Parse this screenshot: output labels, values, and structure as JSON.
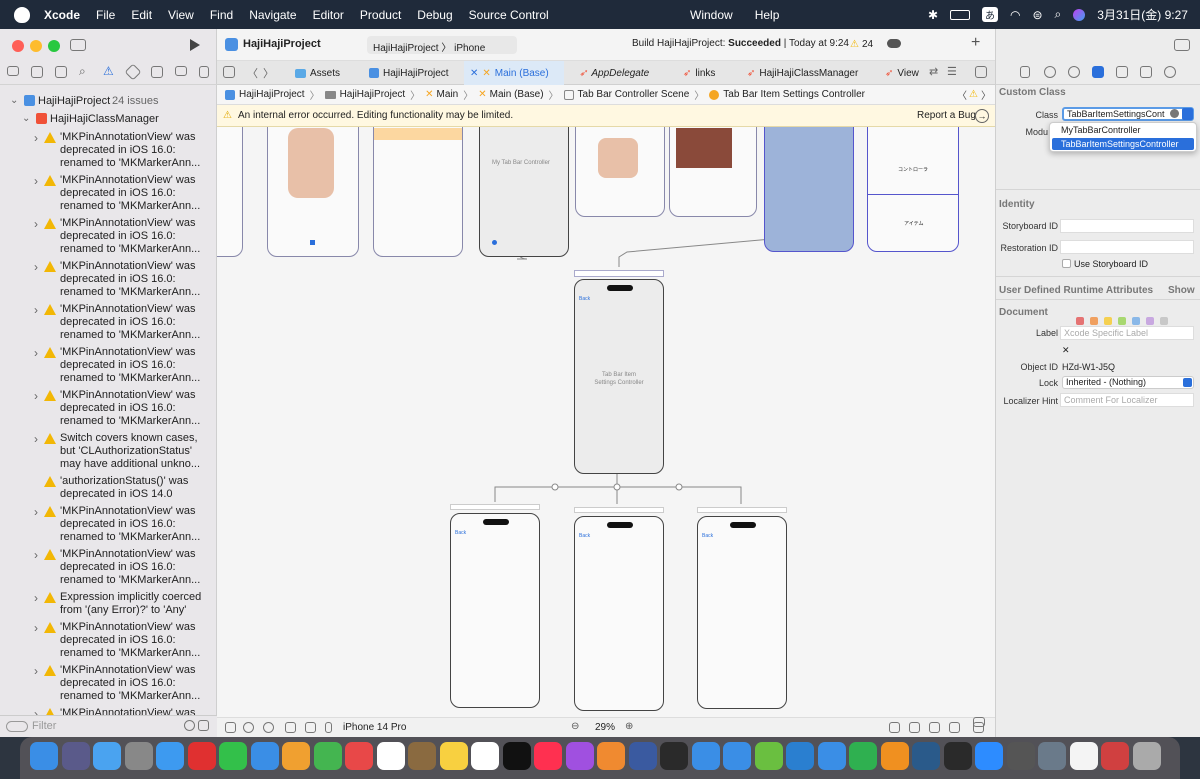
{
  "menubar": {
    "app": "Xcode",
    "items": [
      "File",
      "Edit",
      "View",
      "Find",
      "Navigate",
      "Editor",
      "Product",
      "Debug",
      "Source Control"
    ],
    "right_items": [
      "Window",
      "Help"
    ],
    "ime": "あ",
    "clock": "3月31日(金)  9:27"
  },
  "toolbar": {
    "project": "HajiHajiProject",
    "scheme": "HajiHajiProject",
    "device": "iPhone",
    "status_prefix": "Build HajiHajiProject: ",
    "status_bold": "Succeeded",
    "status_time": " | Today at 9:24",
    "warnings": "24"
  },
  "tabs": [
    "Assets",
    "HajiHajiProject",
    "Main (Base)",
    "AppDelegate",
    "links",
    "HajiHajiClassManager",
    "View"
  ],
  "jumpbar": [
    "HajiHajiProject",
    "HajiHajiProject",
    "Main",
    "Main (Base)",
    "Tab Bar Controller Scene",
    "Tab Bar Item Settings Controller"
  ],
  "banner": {
    "text": "An internal error occurred. Editing functionality may be limited.",
    "action": "Report a Bug"
  },
  "navigator": {
    "root": "HajiHajiProject",
    "root_issues": "24 issues",
    "group": "HajiHajiClassManager",
    "filter_placeholder": "Filter",
    "issues": [
      [
        "'MKPinAnnotationView' was",
        "deprecated in iOS 16.0:",
        "renamed to 'MKMarkerAnn..."
      ],
      [
        "'MKPinAnnotationView' was",
        "deprecated in iOS 16.0:",
        "renamed to 'MKMarkerAnn..."
      ],
      [
        "'MKPinAnnotationView' was",
        "deprecated in iOS 16.0:",
        "renamed to 'MKMarkerAnn..."
      ],
      [
        "'MKPinAnnotationView' was",
        "deprecated in iOS 16.0:",
        "renamed to 'MKMarkerAnn..."
      ],
      [
        "'MKPinAnnotationView' was",
        "deprecated in iOS 16.0:",
        "renamed to 'MKMarkerAnn..."
      ],
      [
        "'MKPinAnnotationView' was",
        "deprecated in iOS 16.0:",
        "renamed to 'MKMarkerAnn..."
      ],
      [
        "'MKPinAnnotationView' was",
        "deprecated in iOS 16.0:",
        "renamed to 'MKMarkerAnn..."
      ],
      [
        "Switch covers known cases,",
        "but 'CLAuthorizationStatus'",
        "may have additional unkno..."
      ],
      [
        "'authorizationStatus()' was",
        "deprecated in iOS 14.0"
      ],
      [
        "'MKPinAnnotationView' was",
        "deprecated in iOS 16.0:",
        "renamed to 'MKMarkerAnn..."
      ],
      [
        "'MKPinAnnotationView' was",
        "deprecated in iOS 16.0:",
        "renamed to 'MKMarkerAnn..."
      ],
      [
        "Expression implicitly coerced",
        "from '(any Error)?' to 'Any'"
      ],
      [
        "'MKPinAnnotationView' was",
        "deprecated in iOS 16.0:",
        "renamed to 'MKMarkerAnn..."
      ],
      [
        "'MKPinAnnotationView' was",
        "deprecated in iOS 16.0:",
        "renamed to 'MKMarkerAnn..."
      ],
      [
        "'MKPinAnnotationView' was"
      ]
    ]
  },
  "canvas": {
    "tabbar_title": "My Tab Bar Controller",
    "center_label_1": "Tab Bar Item",
    "center_label_2": "Settings Controller",
    "back": "Back",
    "jp1": "コントローラ",
    "jp2": "アイテム"
  },
  "bottombar": {
    "device": "iPhone 14 Pro",
    "zoom": "29%"
  },
  "inspector": {
    "custom_class": "Custom Class",
    "class_label": "Class",
    "class_value": "TabBarItemSettingsCont",
    "module_label": "Modu",
    "dropdown": [
      "MyTabBarController",
      "TabBarItemSettingsController"
    ],
    "identity": "Identity",
    "storyboard_id": "Storyboard ID",
    "restoration_id": "Restoration ID",
    "use_storyboard_id": "Use Storyboard ID",
    "udra": "User Defined Runtime Attributes",
    "show": "Show",
    "document": "Document",
    "label": "Label",
    "label_placeholder": "Xcode Specific Label",
    "object_id_label": "Object ID",
    "object_id": "HZd-W1-J5Q",
    "lock_label": "Lock",
    "lock_value": "Inherited - (Nothing)",
    "localizer_label": "Localizer Hint",
    "localizer_placeholder": "Comment For Localizer"
  },
  "colors": {
    "accent": "#2a6fdb",
    "warning": "#f2b705",
    "menubar": "#1f2a3a"
  }
}
